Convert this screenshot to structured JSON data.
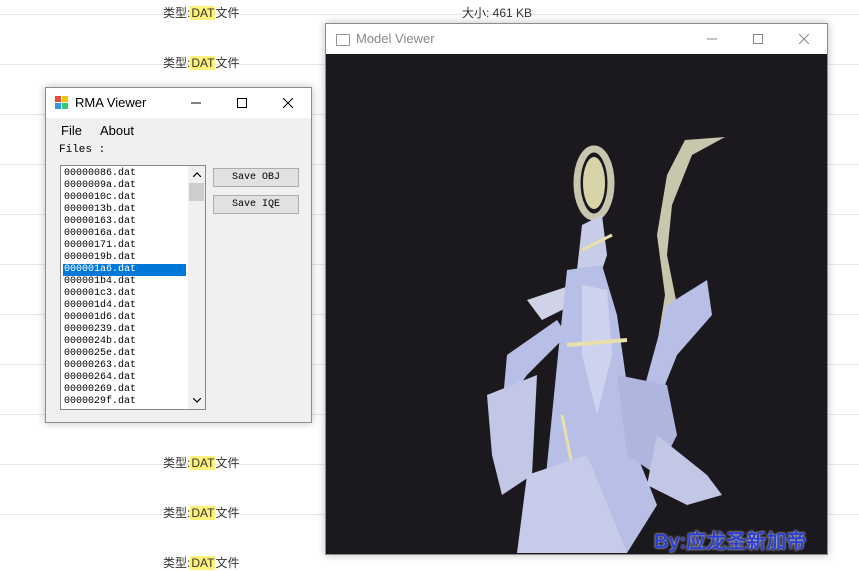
{
  "background": {
    "type_label": "类型:",
    "type_value": "DAT",
    "type_suffix": "文件",
    "size_text": "大小: 461 KB"
  },
  "rma_viewer": {
    "title": "RMA Viewer",
    "menu": {
      "file": "File",
      "about": "About"
    },
    "files_label": "Files :",
    "files": [
      "00000086.dat",
      "0000009a.dat",
      "0000010c.dat",
      "0000013b.dat",
      "00000163.dat",
      "0000016a.dat",
      "00000171.dat",
      "0000019b.dat",
      "000001a6.dat",
      "000001b4.dat",
      "000001c3.dat",
      "000001d4.dat",
      "000001d6.dat",
      "00000239.dat",
      "0000024b.dat",
      "0000025e.dat",
      "00000263.dat",
      "00000264.dat",
      "00000269.dat",
      "0000029f.dat"
    ],
    "selected_file": "000001a6.dat",
    "buttons": {
      "save_obj": "Save OBJ",
      "save_iqe": "Save IQE"
    }
  },
  "model_viewer": {
    "title": "Model Viewer"
  },
  "watermark": "By:应龙圣新加帝",
  "colors": {
    "selection": "#0078d7",
    "viewport_bg": "#1b191d",
    "model_fill": "#b8bfe6",
    "model_highlight": "#e8e0a8",
    "highlight_tag": "#fff27a",
    "watermark": "#2d3fd0"
  }
}
